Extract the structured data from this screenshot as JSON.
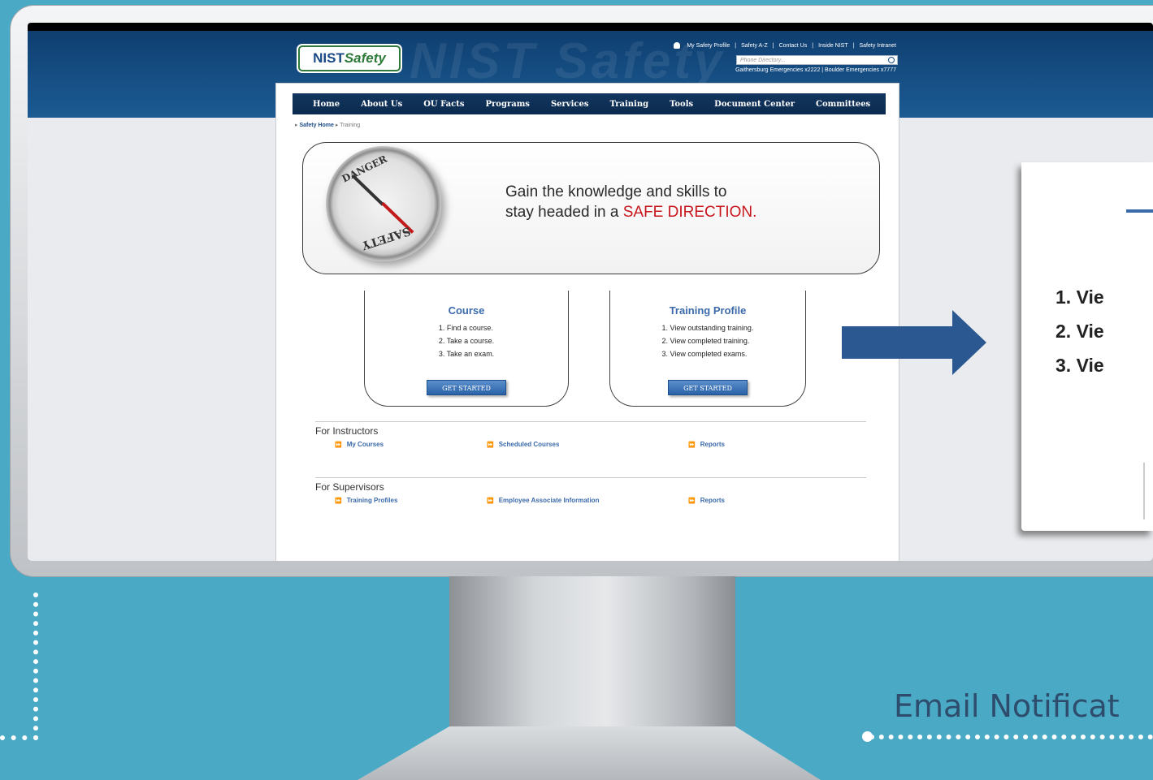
{
  "site": {
    "logo": {
      "bold": "NIST",
      "italic": "Safety"
    },
    "watermark": "NIST Safety",
    "util_links": [
      "My Safety Profile",
      "Safety A-Z",
      "Contact Us",
      "Inside NIST",
      "Safety Intranet"
    ],
    "phone_directory_placeholder": "Phone Directory...",
    "emergency": "Gaithersburg Emergencies x2222  |  Boulder Emergencies x7777",
    "nav": [
      "Home",
      "About Us",
      "OU Facts",
      "Programs",
      "Services",
      "Training",
      "Tools",
      "Document Center",
      "Committees"
    ],
    "breadcrumb": {
      "home": "Safety Home",
      "current": "Training"
    },
    "hero": {
      "line1": "Gain the knowledge and skills to",
      "line2_prefix": "stay headed in a",
      "line2_accent": "SAFE DIRECTION."
    },
    "compass": {
      "top": "DANGER",
      "bottom": "SAFETY"
    },
    "cards": [
      {
        "title": "Course",
        "items": [
          "1.  Find a course.",
          "2.  Take a course.",
          "3.  Take an exam."
        ],
        "button": "GET STARTED"
      },
      {
        "title": "Training Profile",
        "items": [
          "1.  View outstanding training.",
          "2.  View completed training.",
          "3.  View completed exams."
        ],
        "button": "GET STARTED"
      }
    ],
    "instructors": {
      "heading": "For Instructors",
      "links": [
        "My Courses",
        "Scheduled Courses",
        "Reports"
      ]
    },
    "supervisors": {
      "heading": "For Supervisors",
      "links": [
        "Training Profiles",
        "Employee Associate Information",
        "Reports"
      ]
    }
  },
  "zoom": {
    "items": [
      "1.  Vie",
      "2.  Vie",
      "3.  Vie"
    ]
  },
  "caption": "Email Notificat",
  "colors": {
    "background": "#4aaac6",
    "header": "#164f84",
    "accent_red": "#c8161d",
    "link_blue": "#3b6aab",
    "arrow": "#2b5891"
  }
}
